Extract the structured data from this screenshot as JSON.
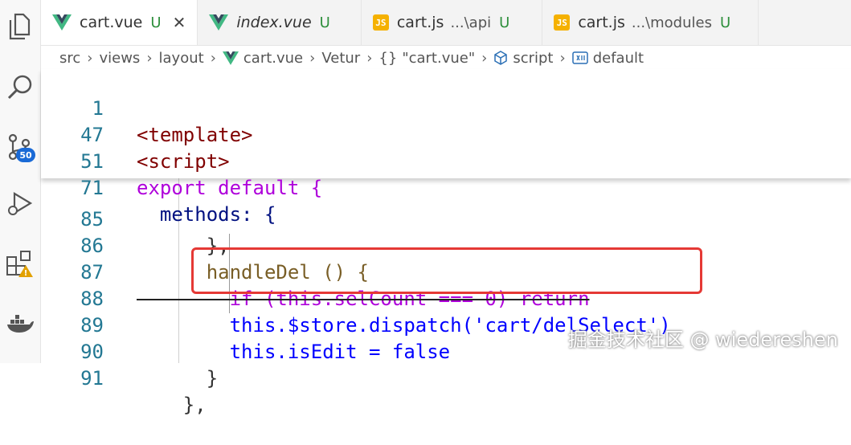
{
  "activity_bar": {
    "scm_badge": "50"
  },
  "tabs": [
    {
      "name": "cart.vue",
      "path": "",
      "status": "U",
      "icon": "vue-icon",
      "active": true,
      "close": "✕"
    },
    {
      "name": "index.vue",
      "path": "",
      "status": "U",
      "icon": "vue-icon",
      "active": false
    },
    {
      "name": "cart.js",
      "path": "...\\api",
      "status": "U",
      "icon": "js-icon",
      "active": false
    },
    {
      "name": "cart.js",
      "path": "...\\modules",
      "status": "U",
      "icon": "js-icon",
      "active": false
    }
  ],
  "js_icon_text": "JS",
  "breadcrumb": [
    "src",
    "views",
    "layout",
    "cart.vue",
    "Vetur",
    "\"cart.vue\"",
    "script",
    "default"
  ],
  "breadcrumb_braces": "{}",
  "sticky_lines": [
    {
      "num": "1",
      "text": "<template>"
    },
    {
      "num": "47",
      "text": "<script>"
    },
    {
      "num": "51",
      "text": "export default {"
    },
    {
      "num": "71",
      "text": "  methods: {"
    }
  ],
  "code_lines": [
    {
      "num": "85",
      "text": "      },"
    },
    {
      "num": "86",
      "text": "      handleDel () {"
    },
    {
      "num": "87",
      "text": "        if (this.selCount === 0) return"
    },
    {
      "num": "88",
      "text": "        this.$store.dispatch('cart/delSelect')"
    },
    {
      "num": "89",
      "text": "        this.isEdit = false"
    },
    {
      "num": "90",
      "text": "      }"
    },
    {
      "num": "91",
      "text": "    },"
    }
  ],
  "watermark": "掘金技术社区 @ wiedereshen"
}
